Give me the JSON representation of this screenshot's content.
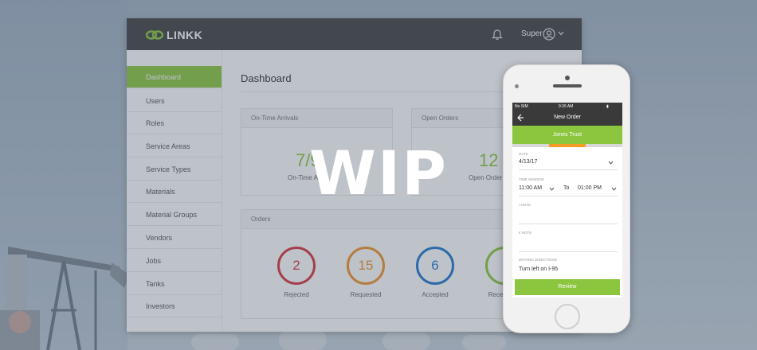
{
  "app": {
    "brand": "LINKK",
    "user": "Super"
  },
  "sidebar": {
    "items": [
      {
        "label": "Dashboard",
        "active": true
      },
      {
        "label": "Users"
      },
      {
        "label": "Roles"
      },
      {
        "label": "Service Areas"
      },
      {
        "label": "Service Types"
      },
      {
        "label": "Materials"
      },
      {
        "label": "Material Groups"
      },
      {
        "label": "Vendors"
      },
      {
        "label": "Jobs"
      },
      {
        "label": "Tanks"
      },
      {
        "label": "Investors"
      }
    ]
  },
  "main": {
    "title": "Dashboard",
    "on_time": {
      "header": "On-Time Arrivals",
      "value": "7/9",
      "label": "On-Time Ar"
    },
    "open_orders": {
      "header": "Open Orders",
      "value": "12",
      "label": "Open Order"
    },
    "orders": {
      "header": "Orders",
      "stats": [
        {
          "value": "2",
          "label": "Rejected",
          "color": "#d9343f"
        },
        {
          "value": "15",
          "label": "Requested",
          "color": "#f0922b"
        },
        {
          "value": "6",
          "label": "Accepted",
          "color": "#1f77d0"
        },
        {
          "value": "",
          "label": "Rece",
          "color": "#8cc63f"
        }
      ]
    }
  },
  "phone": {
    "status": {
      "carrier": "No SIM",
      "time": "9:26 AM"
    },
    "nav_title": "New Order",
    "customer": "Jones Trust",
    "progress": 0.5,
    "fields": {
      "date_label": "DATE",
      "date_value": "4/13/17",
      "time_label": "TIME WINDOW",
      "time_from": "11:00 AM",
      "time_to_label": "To",
      "time_to": "01:00 PM",
      "notes_label": "I NOTE",
      "note2_label": "II NOTE",
      "directions_label": "DRIVING DIRECTIONS",
      "directions_value": "Turn left on I-95"
    },
    "review_label": "Review"
  },
  "overlay_text": "WIP",
  "colors": {
    "accent": "#8cc63f",
    "topbar": "#424242"
  }
}
